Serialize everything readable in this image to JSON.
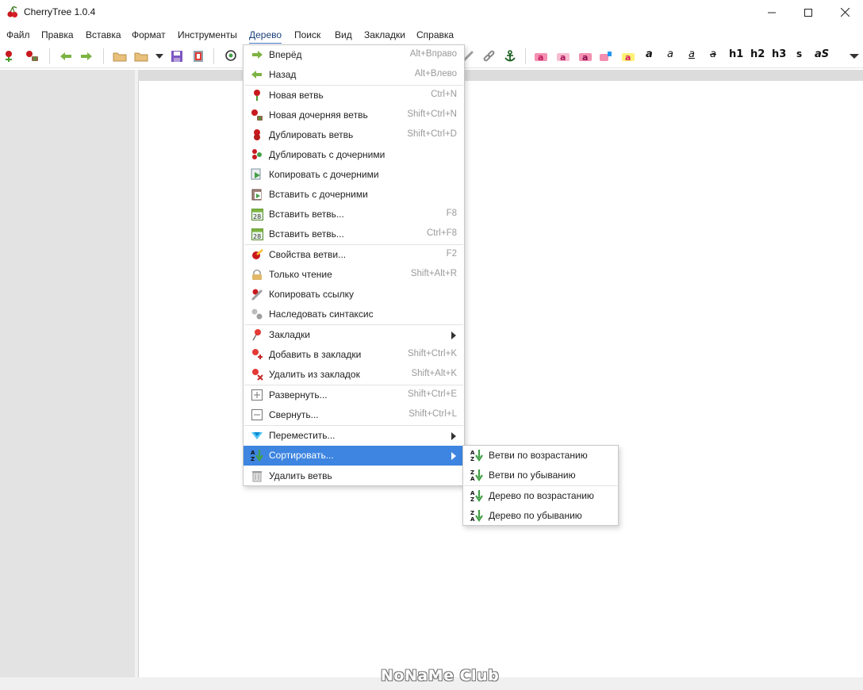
{
  "window": {
    "title": "CherryTree 1.0.4"
  },
  "menubar": [
    "Файл",
    "Правка",
    "Вставка",
    "Формат",
    "Инструменты",
    "Дерево",
    "Поиск",
    "Вид",
    "Закладки",
    "Справка"
  ],
  "format_toolbar": [
    "a",
    "a",
    "a",
    "a",
    "h1",
    "h2",
    "h3",
    "s",
    "aS"
  ],
  "tree_menu": {
    "items": [
      {
        "label": "Вперёд",
        "accel": "Alt+Вправо",
        "icon": "arrow-right-icon"
      },
      {
        "label": "Назад",
        "accel": "Alt+Влево",
        "icon": "arrow-left-icon"
      },
      {
        "label": "Новая ветвь",
        "accel": "Ctrl+N",
        "icon": "new-node-icon"
      },
      {
        "label": "Новая дочерняя ветвь",
        "accel": "Shift+Ctrl+N",
        "icon": "new-child-node-icon"
      },
      {
        "label": "Дублировать ветвь",
        "accel": "Shift+Ctrl+D",
        "icon": "duplicate-node-icon"
      },
      {
        "label": "Дублировать с дочерними",
        "accel": "",
        "icon": "duplicate-subtree-icon"
      },
      {
        "label": "Копировать с дочерними",
        "accel": "",
        "icon": "copy-subtree-icon"
      },
      {
        "label": "Вставить с дочерними",
        "accel": "",
        "icon": "paste-subtree-icon"
      },
      {
        "label": "Вставить ветвь...",
        "accel": "F8",
        "icon": "calendar-icon"
      },
      {
        "label": "Вставить ветвь...",
        "accel": "Ctrl+F8",
        "icon": "calendar-icon"
      },
      {
        "label": "Свойства ветви...",
        "accel": "F2",
        "icon": "node-properties-icon"
      },
      {
        "label": "Только чтение",
        "accel": "Shift+Alt+R",
        "icon": "lock-icon"
      },
      {
        "label": "Копировать ссылку",
        "accel": "",
        "icon": "link-icon"
      },
      {
        "label": "Наследовать синтаксис",
        "accel": "",
        "icon": "inherit-syntax-icon"
      },
      {
        "label": "Закладки",
        "accel": "",
        "icon": "bookmark-pin-icon",
        "submenu": true
      },
      {
        "label": "Добавить в закладки",
        "accel": "Shift+Ctrl+K",
        "icon": "add-bookmark-icon"
      },
      {
        "label": "Удалить из закладок",
        "accel": "Shift+Alt+K",
        "icon": "remove-bookmark-icon"
      },
      {
        "label": "Развернуть...",
        "accel": "Shift+Ctrl+E",
        "icon": "expand-icon"
      },
      {
        "label": "Свернуть...",
        "accel": "Shift+Ctrl+L",
        "icon": "collapse-icon"
      },
      {
        "label": "Переместить...",
        "accel": "",
        "icon": "move-icon",
        "submenu": true
      },
      {
        "label": "Сортировать...",
        "accel": "",
        "icon": "sort-icon",
        "submenu": true,
        "highlighted": true
      },
      {
        "label": "Удалить ветвь",
        "accel": "",
        "icon": "trash-icon"
      }
    ]
  },
  "sort_submenu": {
    "items": [
      {
        "label": "Ветви по возрастанию",
        "icon": "sort-ascending-icon"
      },
      {
        "label": "Ветви по убыванию",
        "icon": "sort-descending-icon"
      },
      {
        "label": "Дерево по возрастанию",
        "icon": "sort-ascending-icon"
      },
      {
        "label": "Дерево по убыванию",
        "icon": "sort-descending-icon"
      }
    ]
  },
  "watermark": "NoNaMe Club",
  "colors": {
    "highlight": "#3d85e0",
    "tree_pane": "#e3e3e3",
    "accel_text": "#9a9a9a"
  }
}
